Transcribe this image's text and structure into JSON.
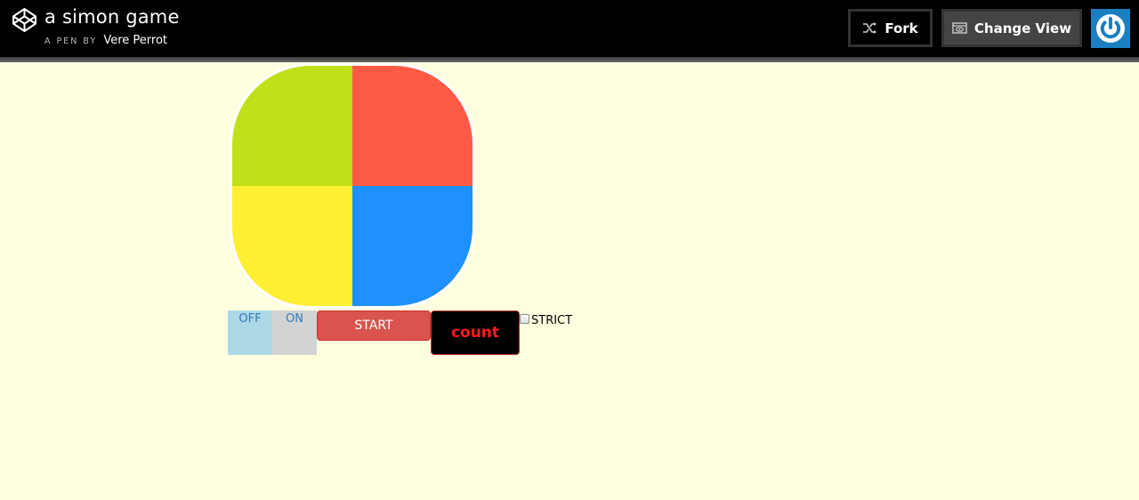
{
  "header": {
    "title": "a simon game",
    "pen_by_label": "A PEN BY",
    "author": "Vere Perrot",
    "logo_icon": "codepen-logo-icon",
    "fork_label": "Fork",
    "fork_icon": "fork-icon",
    "change_view_label": "Change View",
    "change_view_icon": "eye-window-icon",
    "avatar_icon": "power-icon"
  },
  "game": {
    "pads": [
      {
        "name": "green",
        "color": "#c2e01a"
      },
      {
        "name": "red",
        "color": "#ff5a45"
      },
      {
        "name": "yellow",
        "color": "#ffef33"
      },
      {
        "name": "blue",
        "color": "#1e90ff"
      }
    ],
    "off_label": "OFF",
    "on_label": "ON",
    "start_label": "START",
    "count_label": "count",
    "strict_label": "STRICT",
    "strict_checked": false
  },
  "colors": {
    "background": "#ffffe0",
    "header": "#000000",
    "accent": "#1a7fc0"
  }
}
